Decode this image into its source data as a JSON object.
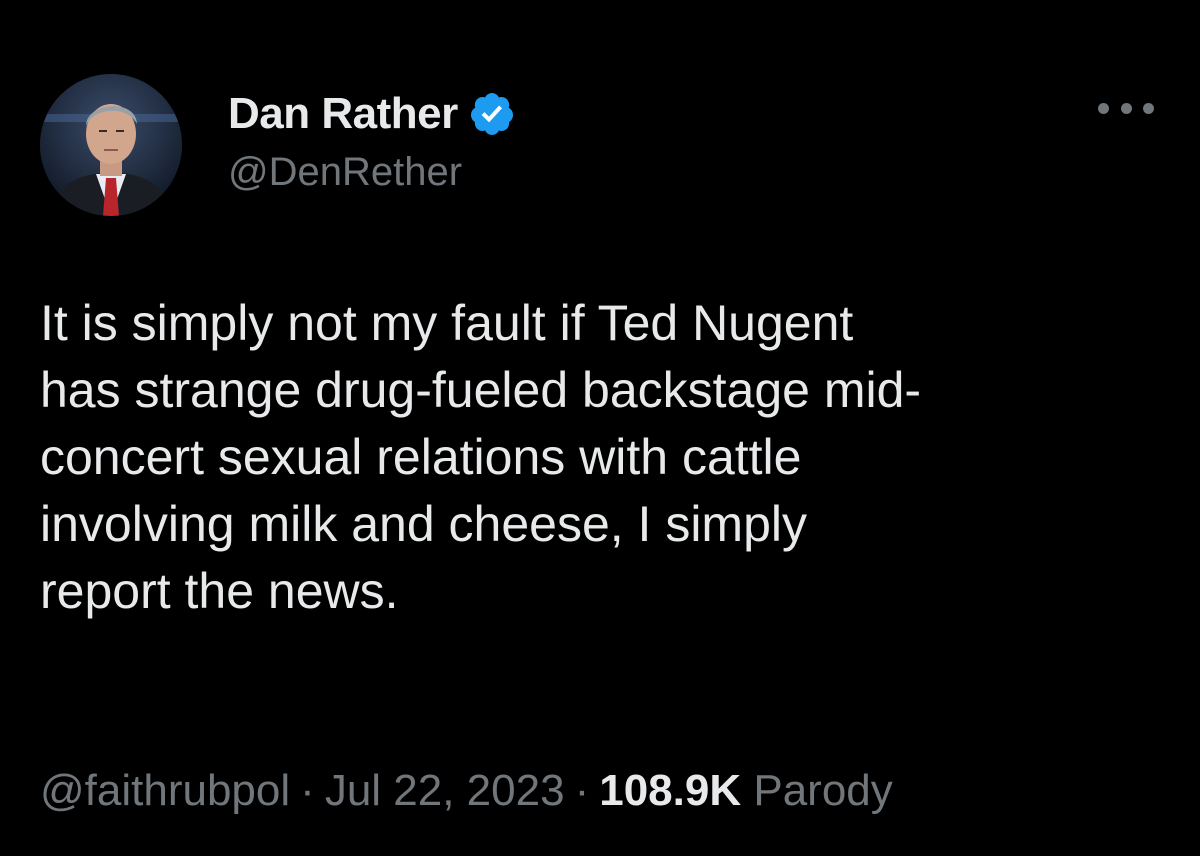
{
  "author": {
    "display_name": "Dan Rather",
    "handle": "@DenRether",
    "verified": true
  },
  "tweet": {
    "lines": [
      "It is simply not my fault if Ted Nugent",
      "has strange drug-fueled backstage mid-",
      "concert sexual relations with cattle",
      "involving milk and cheese, I simply",
      "report the news."
    ]
  },
  "meta": {
    "source_handle": "@faithrubpol",
    "separator": "·",
    "date": "Jul 22, 2023",
    "views_count": "108.9K",
    "label": "Parody"
  },
  "colors": {
    "background": "#000000",
    "primary_text": "#e7e9ea",
    "secondary_text": "#71767b",
    "verified_badge": "#1d9bf0"
  },
  "icons": {
    "verified": "verified-badge-icon",
    "more": "more-options-icon"
  }
}
